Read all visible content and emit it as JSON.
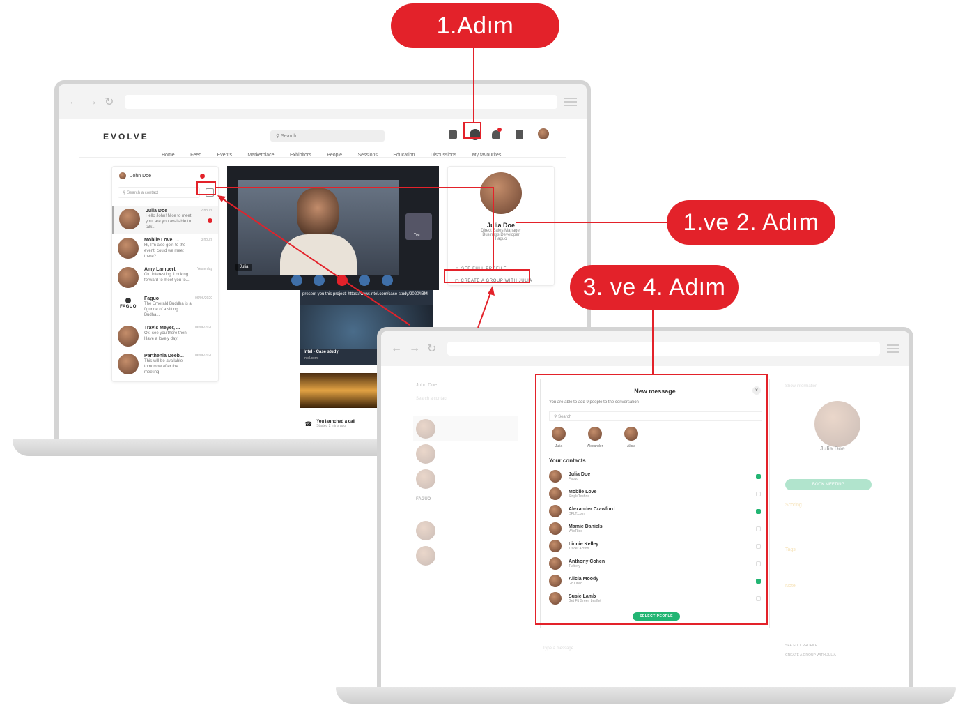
{
  "steps": {
    "step1": "1.Adım",
    "step1_2": "1.ve 2. Adım",
    "step3_4": "3. ve 4. Adım"
  },
  "colors": {
    "accent": "#e3222a",
    "green": "#22b573",
    "call": "#3f6fa8"
  },
  "app": {
    "logo": "EVOLVE",
    "search_placeholder": "Search",
    "nav": [
      "Home",
      "Feed",
      "Events",
      "Marketplace",
      "Exhibitors",
      "People",
      "Sessions",
      "Education",
      "Discussions",
      "My favourites"
    ],
    "header_icons": [
      "home-icon",
      "chat-icon",
      "notification-icon",
      "bookmark-icon",
      "avatar"
    ]
  },
  "chat": {
    "user": "John Doe",
    "search_placeholder": "Search a contact",
    "conversations": [
      {
        "name": "Julia Doe",
        "message": "Hello John! Nice to meet you, are you available to talk...",
        "time": "2 hours",
        "unread": true
      },
      {
        "name": "Mobile Love, ...",
        "message": "Hi, I'm also goin to the event, could we meet there?",
        "time": "3 hours",
        "unread": false
      },
      {
        "name": "Amy Lambert",
        "message": "Ok, interesting. Looking forward to meet you to...",
        "time": "Yesterday",
        "unread": false
      },
      {
        "name": "Faguo",
        "message": "The Emerald Buddha is a figurine of a sitting Budha...",
        "time": "06/06/2020",
        "unread": false
      },
      {
        "name": "Travis Meyer, ...",
        "message": "Ok, see you there then. Have a lovely day!",
        "time": "06/06/2020",
        "unread": false
      },
      {
        "name": "Parthenia Deeb...",
        "message": "This will be available tomorrow after the meeting",
        "time": "06/06/2020",
        "unread": false
      }
    ],
    "faguo_logo": "FAGUO"
  },
  "video": {
    "caller_label": "Julia",
    "self_label": "You"
  },
  "shared": {
    "text": "present you this project: https://www.intel.com/case-study/2020/IBM",
    "link_title": "Intel - Case study",
    "link_sub": "intel.com",
    "call_title": "You launched a call",
    "call_sub": "Started 2 mins ago"
  },
  "profile": {
    "name": "Julia Doe",
    "role1": "Direct Sales Manager",
    "role2": "Business Developer",
    "company": "Faguo",
    "see_full": "SEE FULL PROFILE",
    "create_group": "CREATE A GROUP WITH JULIA"
  },
  "modal": {
    "title": "New message",
    "subtitle": "You are able to add 9 people to the conversation",
    "search_placeholder": "Search",
    "selected": [
      "Julia",
      "Alexander",
      "Alicia"
    ],
    "section": "Your contacts",
    "contacts": [
      {
        "name": "Julia Doe",
        "sub": "Faguo",
        "checked": true
      },
      {
        "name": "Mobile Love",
        "sub": "SingleTechno",
        "checked": false
      },
      {
        "name": "Alexander Crawford",
        "sub": "DPLT.com",
        "checked": true
      },
      {
        "name": "Mamie Daniels",
        "sub": "WildRide",
        "checked": false
      },
      {
        "name": "Linnie Kelley",
        "sub": "Tracer Action",
        "checked": false
      },
      {
        "name": "Anthony Cohen",
        "sub": "Turbery",
        "checked": false
      },
      {
        "name": "Alicia Moody",
        "sub": "GoJubilo",
        "checked": true
      },
      {
        "name": "Susie Lamb",
        "sub": "Get Fit Green Leaflet",
        "checked": false
      }
    ],
    "button": "SELECT PEOPLE"
  },
  "bg_profile": {
    "name": "Julia Doe",
    "book": "BOOK MEETING",
    "scoring": "Scoring",
    "tags": "Tags",
    "note": "Note",
    "see_full": "SEE FULL PROFILE",
    "create_group": "CREATE A GROUP WITH JULIA",
    "show_info": "Show information",
    "type_placeholder": "Type a message..."
  }
}
